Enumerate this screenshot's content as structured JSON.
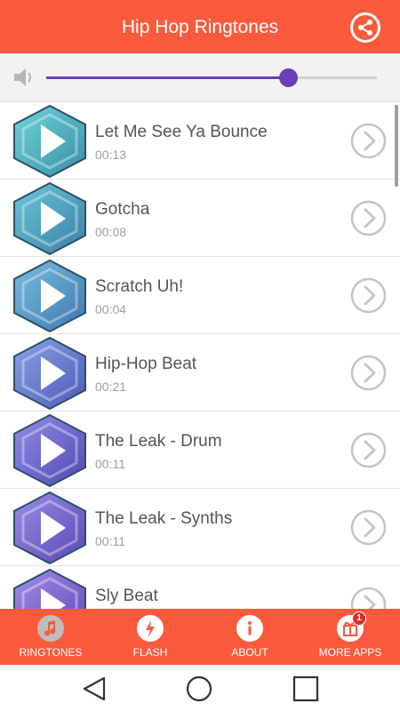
{
  "app": {
    "title": "Hip Hop Ringtones",
    "accent_color": "#fb5a3c",
    "slider_color": "#6a3eb8"
  },
  "toolbar": {
    "share_icon": "share-icon"
  },
  "volume": {
    "icon": "speaker-icon",
    "level": 0.73
  },
  "ringtones": [
    {
      "name": "Let Me See Ya Bounce",
      "duration": "00:13"
    },
    {
      "name": "Gotcha",
      "duration": "00:08"
    },
    {
      "name": "Scratch Uh!",
      "duration": "00:04"
    },
    {
      "name": "Hip-Hop Beat",
      "duration": "00:21"
    },
    {
      "name": "The Leak - Drum",
      "duration": "00:11"
    },
    {
      "name": "The Leak - Synths",
      "duration": "00:11"
    },
    {
      "name": "Sly Beat",
      "duration": ""
    }
  ],
  "tabs": [
    {
      "label": "RINGTONES",
      "icon": "music-note-icon"
    },
    {
      "label": "FLASH",
      "icon": "flash-icon"
    },
    {
      "label": "ABOUT",
      "icon": "info-icon"
    },
    {
      "label": "MORE APPS",
      "icon": "gift-icon",
      "badge": "1"
    }
  ],
  "system_nav": {
    "back": "back-icon",
    "home": "home-icon",
    "recents": "recents-icon"
  }
}
